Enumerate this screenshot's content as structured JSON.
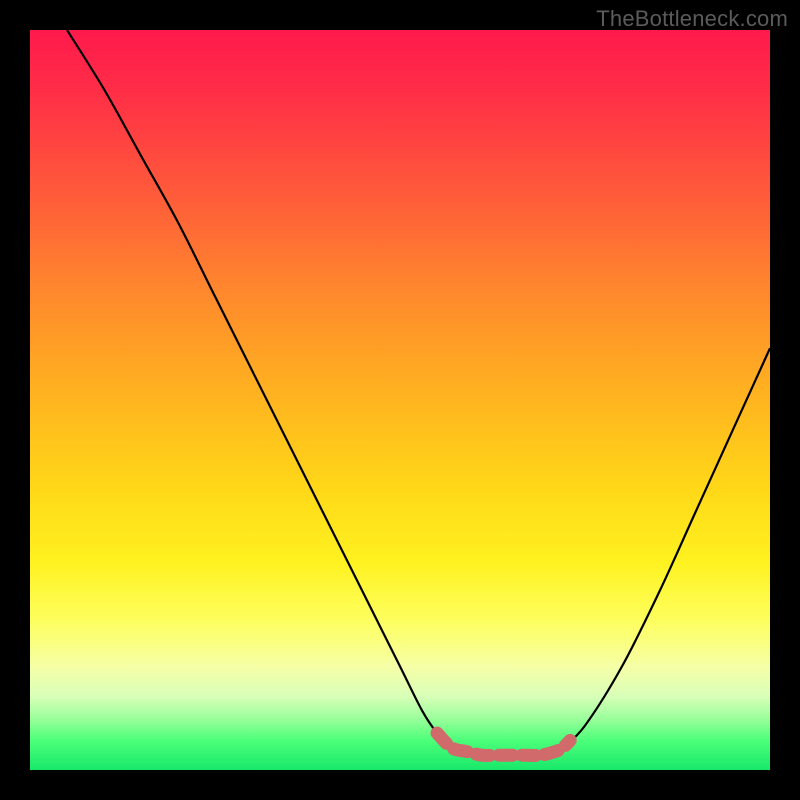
{
  "watermark": "TheBottleneck.com",
  "chart_data": {
    "type": "line",
    "title": "",
    "xlabel": "",
    "ylabel": "",
    "xlim": [
      0,
      100
    ],
    "ylim": [
      0,
      100
    ],
    "series": [
      {
        "name": "left-curve",
        "x": [
          5,
          10,
          15,
          20,
          25,
          30,
          35,
          40,
          45,
          50,
          53,
          55,
          57
        ],
        "y": [
          100,
          92,
          83,
          74,
          64,
          54,
          44,
          34,
          24,
          14,
          8,
          5,
          3
        ]
      },
      {
        "name": "floor-segment",
        "x": [
          57,
          61,
          66,
          70,
          72
        ],
        "y": [
          3,
          2,
          2,
          2,
          3
        ]
      },
      {
        "name": "right-curve",
        "x": [
          72,
          75,
          80,
          85,
          90,
          95,
          100
        ],
        "y": [
          3,
          6,
          14,
          24,
          35,
          46,
          57
        ]
      },
      {
        "name": "highlight-dots",
        "x": [
          55,
          57,
          59,
          61,
          63,
          65,
          67,
          69,
          71,
          72,
          73
        ],
        "y": [
          5,
          3,
          2.5,
          2,
          2,
          2,
          2,
          2,
          2.5,
          3,
          4
        ]
      }
    ],
    "colors": {
      "line": "#000000",
      "highlight": "#d16a6a",
      "gradient_top": "#ff1a4c",
      "gradient_bottom": "#18e86a"
    }
  }
}
